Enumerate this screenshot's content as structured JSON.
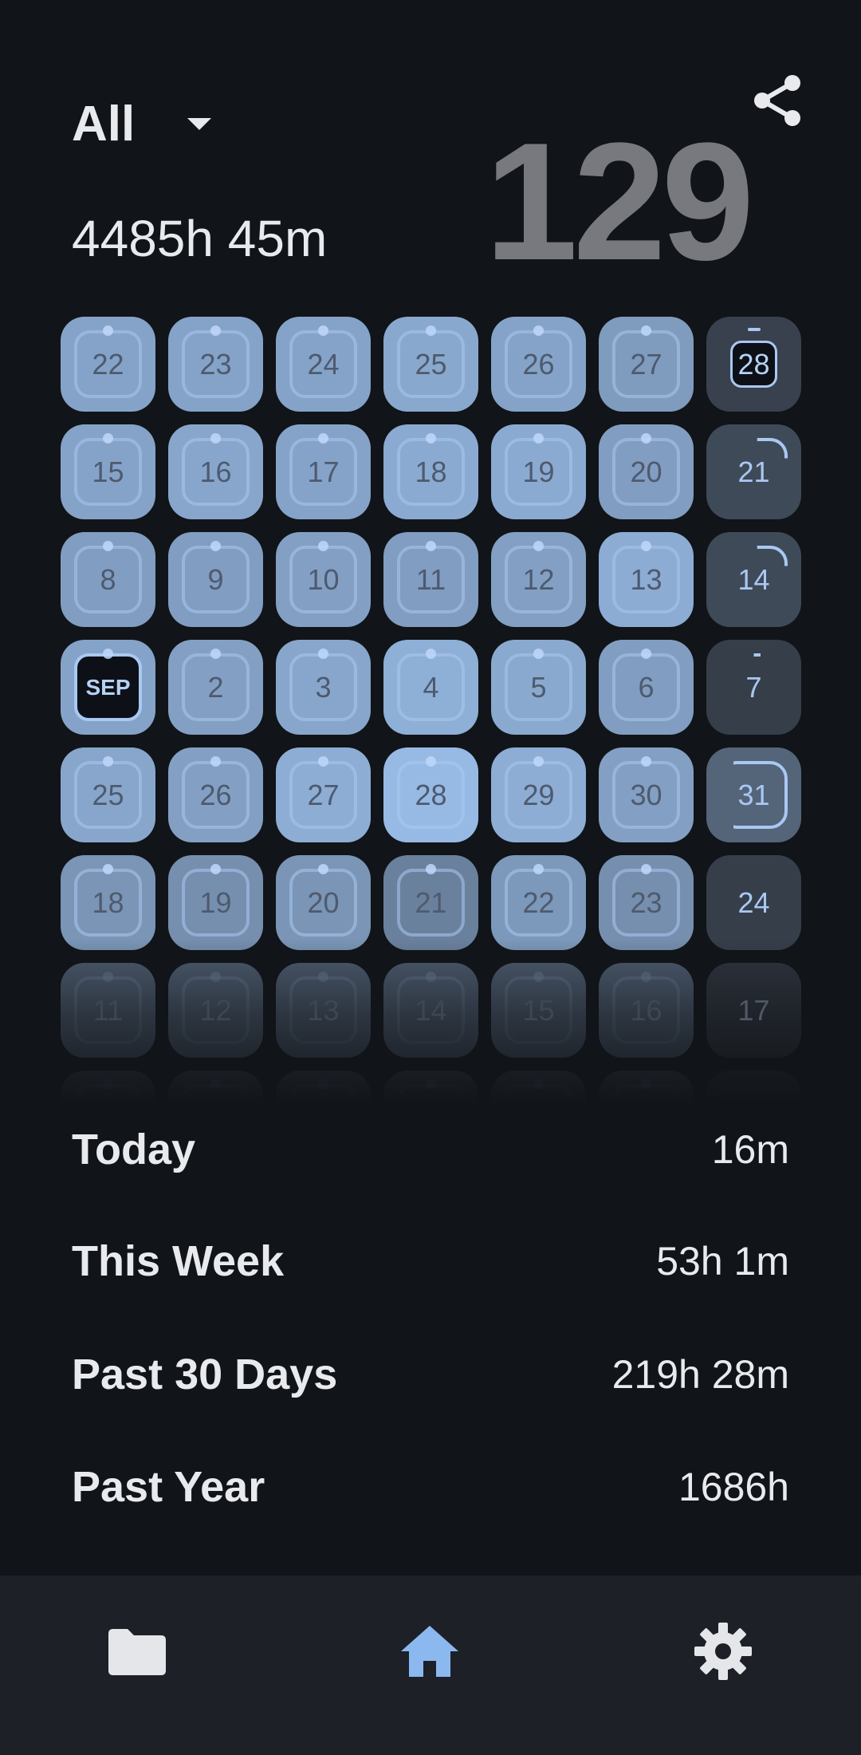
{
  "header": {
    "filter_label": "All",
    "total_time": "4485h 45m",
    "big_count": "129"
  },
  "calendar": {
    "rows": [
      [
        "22",
        "23",
        "24",
        "25",
        "26",
        "27",
        "28"
      ],
      [
        "15",
        "16",
        "17",
        "18",
        "19",
        "20",
        "21"
      ],
      [
        "8",
        "9",
        "10",
        "11",
        "12",
        "13",
        "14"
      ],
      [
        "SEP",
        "2",
        "3",
        "4",
        "5",
        "6",
        "7"
      ],
      [
        "25",
        "26",
        "27",
        "28",
        "29",
        "30",
        "31"
      ],
      [
        "18",
        "19",
        "20",
        "21",
        "22",
        "23",
        "24"
      ],
      [
        "11",
        "12",
        "13",
        "14",
        "15",
        "16",
        "17"
      ]
    ]
  },
  "stats": [
    {
      "label": "Today",
      "value": "16m"
    },
    {
      "label": "This Week",
      "value": "53h 1m"
    },
    {
      "label": "Past 30 Days",
      "value": "219h 28m"
    },
    {
      "label": "Past Year",
      "value": "1686h"
    }
  ],
  "nav": {
    "items": [
      {
        "icon": "folder-icon"
      },
      {
        "icon": "home-icon",
        "active": true
      },
      {
        "icon": "gear-icon"
      }
    ]
  },
  "colors": {
    "background": "#111418",
    "accent": "#8cb8f0",
    "nav_background": "#1d2026",
    "count_gray": "#78797e"
  }
}
